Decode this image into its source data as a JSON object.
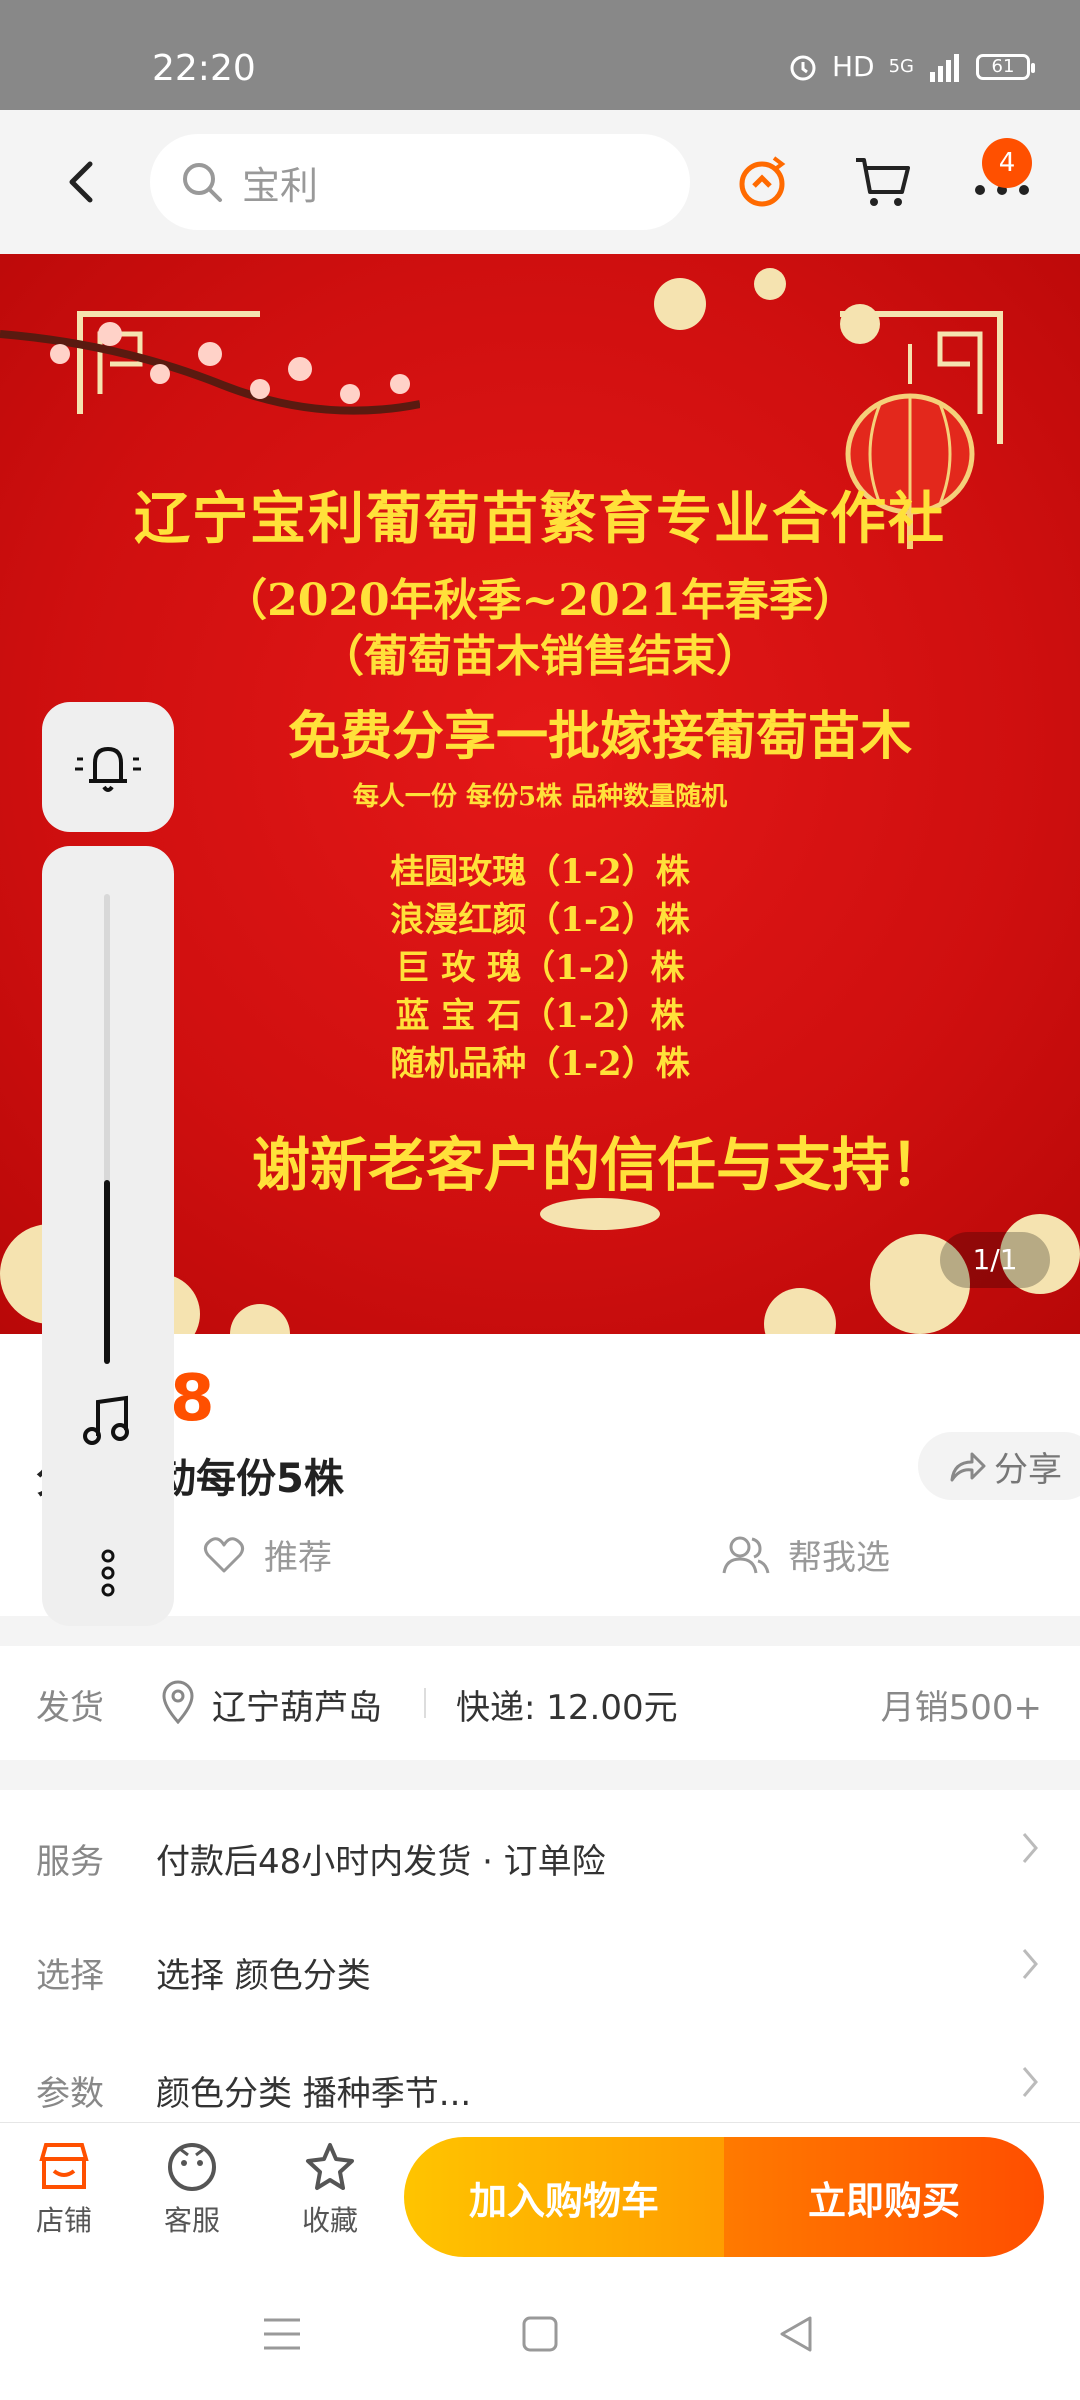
{
  "status": {
    "time": "22:20",
    "hd": "HD",
    "net": "5G",
    "battery": "61"
  },
  "header": {
    "search_text": "宝利",
    "cart_badge": "4"
  },
  "banner": {
    "line1": "辽宁宝利葡萄苗繁育专业合作社",
    "line2": "（2020年秋季~2021年春季）",
    "line3": "（葡萄苗木销售结束）",
    "line4": "免费分享一批嫁接葡萄苗木",
    "line5": "每人一份  每份5株  品种数量随机",
    "varieties": [
      "桂圆玫瑰（1-2）株",
      "浪漫红颜（1-2）株",
      "巨 玫 瑰（1-2）株",
      "蓝 宝 石（1-2）株",
      "随机品种（1-2）株"
    ],
    "thanks": "谢新老客户的信任与支持！",
    "page_indicator": "1/1"
  },
  "product": {
    "price": "8",
    "title": "分享活动每份5株",
    "share": "分享",
    "recommend": "推荐",
    "help_choose": "帮我选"
  },
  "shipping": {
    "label": "发货",
    "location": "辽宁葫芦岛",
    "express": "快递: 12.00元",
    "monthly_sales": "月销500+"
  },
  "rows": [
    {
      "label": "服务",
      "value": "付款后48小时内发货 · 订单险"
    },
    {
      "label": "选择",
      "value": "选择 颜色分类"
    },
    {
      "label": "参数",
      "value": "颜色分类 播种季节..."
    }
  ],
  "bottom": {
    "shop": "店铺",
    "service": "客服",
    "favorite": "收藏",
    "add_to_cart": "加入购物车",
    "buy_now": "立即购买"
  },
  "colors": {
    "accent": "#ff5000",
    "banner_red": "#d41212",
    "banner_text": "#ffe13a"
  }
}
